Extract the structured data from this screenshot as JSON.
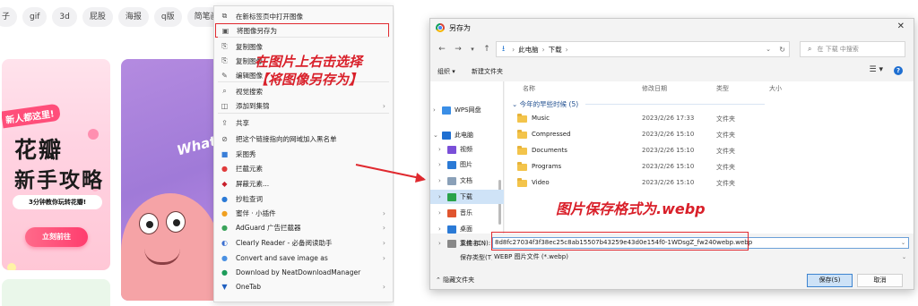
{
  "browser_page": {
    "tags": [
      "子",
      "gif",
      "3d",
      "屁股",
      "海报",
      "q版",
      "简笔画"
    ],
    "card1": {
      "ribbon": "新人都这里!",
      "title_line1": "花瓣",
      "title_line2": "新手攻略",
      "subtitle": "3分钟教你玩转花瓣!",
      "cta": "立刻前往"
    },
    "card2": {
      "text": "What"
    }
  },
  "context_menu": {
    "items": [
      {
        "label": "在新标签页中打开图像",
        "icon": "new-tab-icon",
        "chevron": false
      },
      {
        "label": "将图像另存为",
        "icon": "save-image-icon",
        "chevron": false,
        "highlight": true
      },
      {
        "label": "复制图像",
        "icon": "copy-icon",
        "chevron": false
      },
      {
        "label": "复制图像",
        "icon": "copy-link-icon",
        "chevron": false
      },
      {
        "label": "编辑图像",
        "icon": "edit-icon",
        "chevron": false
      },
      {
        "label": "视觉搜索",
        "icon": "visual-search-icon",
        "chevron": false
      },
      {
        "label": "添加到集锦",
        "icon": "collection-icon",
        "chevron": true
      },
      {
        "label": "共享",
        "icon": "share-icon",
        "chevron": false
      },
      {
        "label": "把这个链接指向的网域加入黑名单",
        "icon": "block-icon",
        "chevron": false
      },
      {
        "label": "采图秀",
        "icon": "app-icon",
        "chevron": false
      },
      {
        "label": "拦截元素",
        "icon": "adblock-icon",
        "chevron": false
      },
      {
        "label": "屏蔽元素...",
        "icon": "shield-icon",
        "chevron": false
      },
      {
        "label": "抄粒查词",
        "icon": "dictionary-icon",
        "chevron": false
      },
      {
        "label": "蜜伴 · 小插件",
        "icon": "plugin-icon",
        "chevron": true
      },
      {
        "label": "AdGuard 广告拦截器",
        "icon": "adguard-icon",
        "chevron": true
      },
      {
        "label": "Clearly Reader - 必备阅读助手",
        "icon": "reader-icon",
        "chevron": true
      },
      {
        "label": "Convert and save image as",
        "icon": "convert-icon",
        "chevron": true
      },
      {
        "label": "Download by NeatDownloadManager",
        "icon": "download-icon",
        "chevron": false
      },
      {
        "label": "OneTab",
        "icon": "onetab-icon",
        "chevron": true
      }
    ]
  },
  "annotations": {
    "left_line1": "在图片上右击选择",
    "left_line2": "【将图像另存为】",
    "right": "图片保存格式为.webp"
  },
  "dialog": {
    "title": "另存为",
    "nav": {
      "back": "←",
      "forward": "→",
      "up": "↑",
      "crumbs": [
        "此电脑",
        "下载"
      ],
      "search_placeholder": "在 下载 中搜索"
    },
    "toolbar": {
      "organize": "组织 ▾",
      "new_folder": "新建文件夹",
      "view": "☰ ▾",
      "help": "?"
    },
    "tree": [
      {
        "label": "WPS网盘",
        "color": "#3a8ee6",
        "selected": false
      },
      {
        "label": "此电脑",
        "color": "#1f6fd1",
        "selected": false
      },
      {
        "label": "视频",
        "color": "#7a4fd8",
        "selected": false
      },
      {
        "label": "图片",
        "color": "#2b7ad6",
        "selected": false
      },
      {
        "label": "文档",
        "color": "#8aa0b8",
        "selected": false
      },
      {
        "label": "下载",
        "color": "#2aa34a",
        "selected": true
      },
      {
        "label": "音乐",
        "color": "#e0552f",
        "selected": false
      },
      {
        "label": "桌面",
        "color": "#2b7ad6",
        "selected": false
      },
      {
        "label": "系统 (C:)",
        "color": "#888888",
        "selected": false
      }
    ],
    "columns": [
      "名称",
      "修改日期",
      "类型",
      "大小"
    ],
    "group": "今年的早些时候 (5)",
    "files": [
      {
        "name": "Music",
        "date": "2023/2/26 17:33",
        "type": "文件夹"
      },
      {
        "name": "Compressed",
        "date": "2023/2/26 15:10",
        "type": "文件夹"
      },
      {
        "name": "Documents",
        "date": "2023/2/26 15:10",
        "type": "文件夹"
      },
      {
        "name": "Programs",
        "date": "2023/2/26 15:10",
        "type": "文件夹"
      },
      {
        "name": "Video",
        "date": "2023/2/26 15:10",
        "type": "文件夹"
      }
    ],
    "filename_label": "文件名(N):",
    "filename_value": "8d8fc27034f3f38ec25c8ab15507b43259e43d0e154f0-1WDsgZ_fw240webp.webp",
    "filetype_label": "保存类型(T):",
    "filetype_value": "WEBP 图片文件 (*.webp)",
    "hide_folders": "隐藏文件夹",
    "save_label": "保存(S)",
    "cancel_label": "取消"
  }
}
